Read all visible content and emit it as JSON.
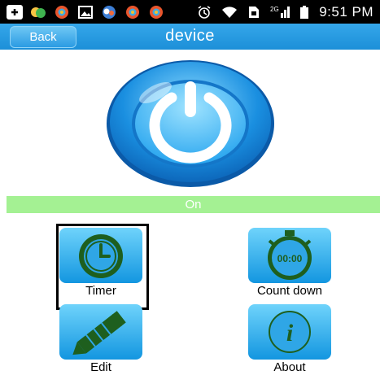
{
  "status_bar": {
    "time": "9:51 PM",
    "notification_icons": [
      "add-box-icon",
      "app-icon",
      "browser-icon",
      "gallery-icon",
      "app-icon-2",
      "browser-icon-2",
      "browser-icon-3"
    ],
    "system_icons": [
      "alarm-icon",
      "wifi-icon",
      "sim-icon",
      "signal-icon",
      "battery-icon"
    ],
    "network_label": "2G"
  },
  "header": {
    "back_label": "Back",
    "title": "device"
  },
  "power": {
    "icon": "power-icon",
    "state": "On"
  },
  "menu": [
    {
      "label": "Timer",
      "icon": "clock-icon",
      "selected": true
    },
    {
      "label": "Count down",
      "icon": "stopwatch-icon",
      "display": "00:00"
    },
    {
      "label": "Edit",
      "icon": "pencil-icon"
    },
    {
      "label": "About",
      "icon": "info-icon",
      "glyph": "i"
    }
  ],
  "colors": {
    "app_bar": "#2799df",
    "tile": "#22a8e8",
    "state_bar": "#a4f193",
    "icon_green": "#1e5f1e"
  }
}
